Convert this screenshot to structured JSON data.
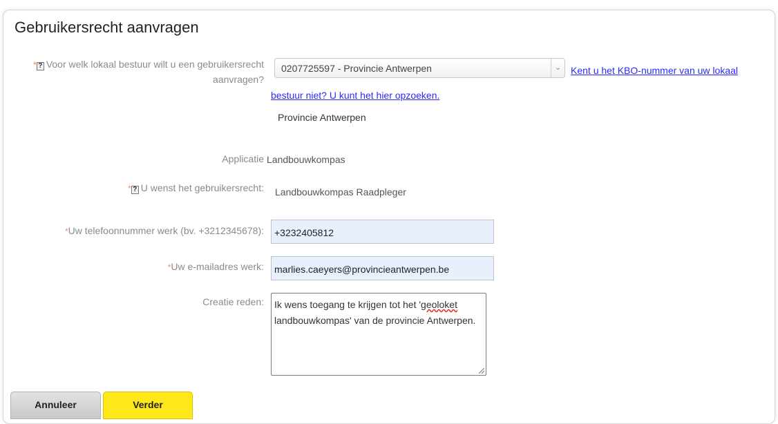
{
  "page": {
    "title": "Gebruikersrecht aanvragen"
  },
  "form": {
    "required_mark": "*",
    "help_icon": "?",
    "bestuur": {
      "label_line1": "Voor welk lokaal bestuur wilt u een gebruikersrecht",
      "label_line2": "aanvragen?",
      "selected": "0207725597 - Provincie Antwerpen",
      "link_line1": "Kent u het KBO-nummer van uw lokaal",
      "link_line2": "bestuur niet? U kunt het hier opzoeken.",
      "resolved_name": "Provincie Antwerpen"
    },
    "applicatie": {
      "label": "Applicatie",
      "value": "Landbouwkompas"
    },
    "gebruikersrecht": {
      "label": "U wenst het gebruikersrecht:",
      "value": "Landbouwkompas Raadpleger"
    },
    "telefoon": {
      "label": "Uw telefoonnummer werk (bv. +3212345678):",
      "value": "+3232405812"
    },
    "email": {
      "label": "Uw e-mailadres werk:",
      "value": "marlies.caeyers@provincieantwerpen.be"
    },
    "reden": {
      "label": "Creatie reden:",
      "text_part1": "Ik wens toegang te krijgen tot het '",
      "text_misspelled": "geoloket",
      "text_part2": "landbouwkompas' van de provincie Antwerpen."
    }
  },
  "buttons": {
    "cancel": "Annuleer",
    "next": "Verder"
  },
  "colors": {
    "accent_yellow": "#ffe81a",
    "link_blue": "#2a2aff",
    "required_orange": "#f08a4b",
    "autofill_blue": "#e8f0fe"
  }
}
